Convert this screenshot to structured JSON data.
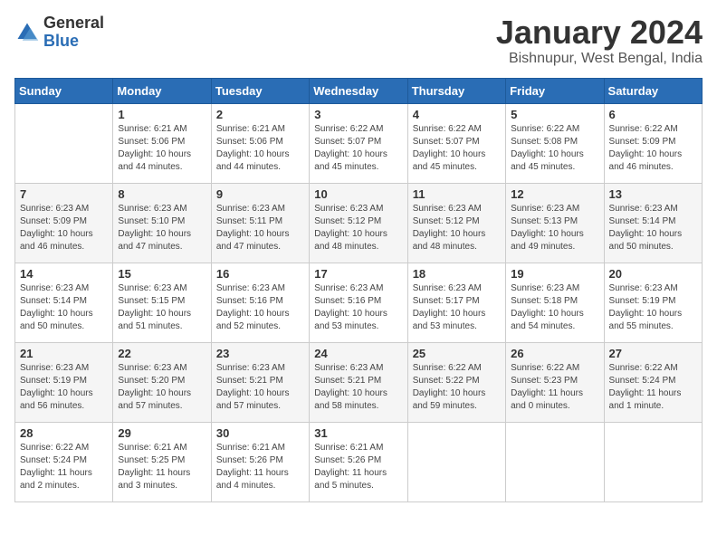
{
  "header": {
    "logo_general": "General",
    "logo_blue": "Blue",
    "month_title": "January 2024",
    "location": "Bishnupur, West Bengal, India"
  },
  "days_of_week": [
    "Sunday",
    "Monday",
    "Tuesday",
    "Wednesday",
    "Thursday",
    "Friday",
    "Saturday"
  ],
  "weeks": [
    [
      {
        "day": "",
        "info": ""
      },
      {
        "day": "1",
        "info": "Sunrise: 6:21 AM\nSunset: 5:06 PM\nDaylight: 10 hours\nand 44 minutes."
      },
      {
        "day": "2",
        "info": "Sunrise: 6:21 AM\nSunset: 5:06 PM\nDaylight: 10 hours\nand 44 minutes."
      },
      {
        "day": "3",
        "info": "Sunrise: 6:22 AM\nSunset: 5:07 PM\nDaylight: 10 hours\nand 45 minutes."
      },
      {
        "day": "4",
        "info": "Sunrise: 6:22 AM\nSunset: 5:07 PM\nDaylight: 10 hours\nand 45 minutes."
      },
      {
        "day": "5",
        "info": "Sunrise: 6:22 AM\nSunset: 5:08 PM\nDaylight: 10 hours\nand 45 minutes."
      },
      {
        "day": "6",
        "info": "Sunrise: 6:22 AM\nSunset: 5:09 PM\nDaylight: 10 hours\nand 46 minutes."
      }
    ],
    [
      {
        "day": "7",
        "info": "Sunrise: 6:23 AM\nSunset: 5:09 PM\nDaylight: 10 hours\nand 46 minutes."
      },
      {
        "day": "8",
        "info": "Sunrise: 6:23 AM\nSunset: 5:10 PM\nDaylight: 10 hours\nand 47 minutes."
      },
      {
        "day": "9",
        "info": "Sunrise: 6:23 AM\nSunset: 5:11 PM\nDaylight: 10 hours\nand 47 minutes."
      },
      {
        "day": "10",
        "info": "Sunrise: 6:23 AM\nSunset: 5:12 PM\nDaylight: 10 hours\nand 48 minutes."
      },
      {
        "day": "11",
        "info": "Sunrise: 6:23 AM\nSunset: 5:12 PM\nDaylight: 10 hours\nand 48 minutes."
      },
      {
        "day": "12",
        "info": "Sunrise: 6:23 AM\nSunset: 5:13 PM\nDaylight: 10 hours\nand 49 minutes."
      },
      {
        "day": "13",
        "info": "Sunrise: 6:23 AM\nSunset: 5:14 PM\nDaylight: 10 hours\nand 50 minutes."
      }
    ],
    [
      {
        "day": "14",
        "info": "Sunrise: 6:23 AM\nSunset: 5:14 PM\nDaylight: 10 hours\nand 50 minutes."
      },
      {
        "day": "15",
        "info": "Sunrise: 6:23 AM\nSunset: 5:15 PM\nDaylight: 10 hours\nand 51 minutes."
      },
      {
        "day": "16",
        "info": "Sunrise: 6:23 AM\nSunset: 5:16 PM\nDaylight: 10 hours\nand 52 minutes."
      },
      {
        "day": "17",
        "info": "Sunrise: 6:23 AM\nSunset: 5:16 PM\nDaylight: 10 hours\nand 53 minutes."
      },
      {
        "day": "18",
        "info": "Sunrise: 6:23 AM\nSunset: 5:17 PM\nDaylight: 10 hours\nand 53 minutes."
      },
      {
        "day": "19",
        "info": "Sunrise: 6:23 AM\nSunset: 5:18 PM\nDaylight: 10 hours\nand 54 minutes."
      },
      {
        "day": "20",
        "info": "Sunrise: 6:23 AM\nSunset: 5:19 PM\nDaylight: 10 hours\nand 55 minutes."
      }
    ],
    [
      {
        "day": "21",
        "info": "Sunrise: 6:23 AM\nSunset: 5:19 PM\nDaylight: 10 hours\nand 56 minutes."
      },
      {
        "day": "22",
        "info": "Sunrise: 6:23 AM\nSunset: 5:20 PM\nDaylight: 10 hours\nand 57 minutes."
      },
      {
        "day": "23",
        "info": "Sunrise: 6:23 AM\nSunset: 5:21 PM\nDaylight: 10 hours\nand 57 minutes."
      },
      {
        "day": "24",
        "info": "Sunrise: 6:23 AM\nSunset: 5:21 PM\nDaylight: 10 hours\nand 58 minutes."
      },
      {
        "day": "25",
        "info": "Sunrise: 6:22 AM\nSunset: 5:22 PM\nDaylight: 10 hours\nand 59 minutes."
      },
      {
        "day": "26",
        "info": "Sunrise: 6:22 AM\nSunset: 5:23 PM\nDaylight: 11 hours\nand 0 minutes."
      },
      {
        "day": "27",
        "info": "Sunrise: 6:22 AM\nSunset: 5:24 PM\nDaylight: 11 hours\nand 1 minute."
      }
    ],
    [
      {
        "day": "28",
        "info": "Sunrise: 6:22 AM\nSunset: 5:24 PM\nDaylight: 11 hours\nand 2 minutes."
      },
      {
        "day": "29",
        "info": "Sunrise: 6:21 AM\nSunset: 5:25 PM\nDaylight: 11 hours\nand 3 minutes."
      },
      {
        "day": "30",
        "info": "Sunrise: 6:21 AM\nSunset: 5:26 PM\nDaylight: 11 hours\nand 4 minutes."
      },
      {
        "day": "31",
        "info": "Sunrise: 6:21 AM\nSunset: 5:26 PM\nDaylight: 11 hours\nand 5 minutes."
      },
      {
        "day": "",
        "info": ""
      },
      {
        "day": "",
        "info": ""
      },
      {
        "day": "",
        "info": ""
      }
    ]
  ]
}
